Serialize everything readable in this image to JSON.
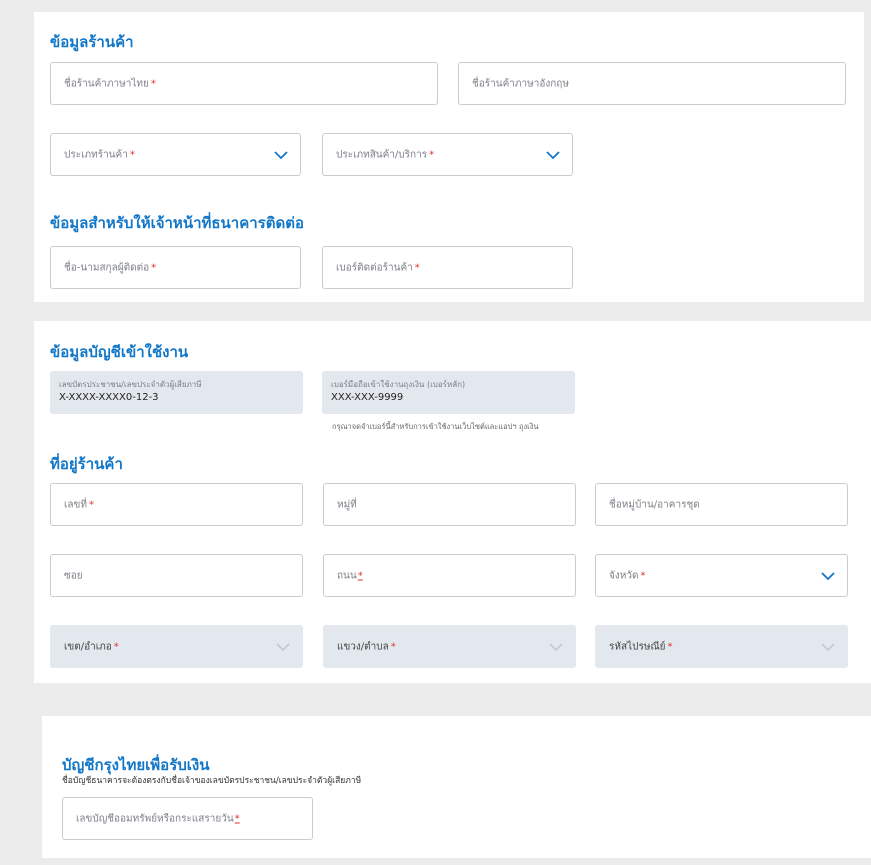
{
  "shop_info": {
    "title": "ข้อมูลร้านค้า",
    "shop_name_th": "ชื่อร้านค้าภาษาไทย",
    "shop_name_en": "ชื่อร้านค้าภาษาอังกฤษ",
    "shop_type": "ประเภทร้านค้า",
    "product_type": "ประเภทสินค้า/บริการ"
  },
  "contact_info": {
    "title": "ข้อมูลสำหรับให้เจ้าหน้าที่ธนาคารติดต่อ",
    "contact_name": "ชื่อ-นามสกุลผู้ติดต่อ",
    "shop_phone": "เบอร์ติดต่อร้านค้า"
  },
  "account_info": {
    "title": "ข้อมูลบัญชีเข้าใช้งาน",
    "id_label": "เลขบัตรประชาชน/เลขประจำตัวผู้เสียภาษี",
    "id_value": "X-XXXX-XXXX0-12-3",
    "mobile_label": "เบอร์มือถือเข้าใช้งานถุงเงิน (เบอร์หลัก)",
    "mobile_value": "XXX-XXX-9999",
    "mobile_hint": "กรุณาจดจำเบอร์นี้สำหรับการเข้าใช้งานเว็บไซต์และแอปฯ ถุงเงิน"
  },
  "address": {
    "title": "ที่อยู่ร้านค้า",
    "house_no": "เลขที่",
    "moo": "หมู่ที่",
    "village": "ชื่อหมู่บ้าน/อาคารชุด",
    "soi": "ซอย",
    "road": "ถนน",
    "province": "จังหวัด",
    "district": "เขต/อำเภอ",
    "subdistrict": "แขวง/ตำบล",
    "postcode": "รหัสไปรษณีย์"
  },
  "bank_account": {
    "title": "บัญชีกรุงไทยเพื่อรับเงิน",
    "subtitle": "ชื่อบัญชีธนาคารจะต้องตรงกับชื่อเจ้าของเลขบัตรประชาชน/เลขประจำตัวผู้เสียภาษี",
    "account_no": "เลขบัญชีออมทรัพย์หรือกระแสรายวัน"
  },
  "required_mark": "*",
  "colors": {
    "accent": "#1377c8",
    "required": "#e03131",
    "disabled_bg": "#e3e8ee"
  }
}
